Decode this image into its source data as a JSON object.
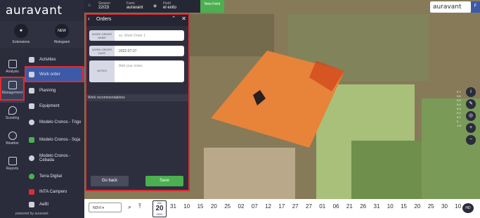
{
  "brand": {
    "logo": "auravant"
  },
  "quick": {
    "extensions": "Extensions",
    "histogram": "Histogram",
    "new_badge": "NEW"
  },
  "rail": [
    {
      "label": "Analysis"
    },
    {
      "label": "Management"
    },
    {
      "label": "Scouting"
    },
    {
      "label": "Weather"
    },
    {
      "label": "Reports"
    }
  ],
  "submenu": [
    {
      "label": "Activities"
    },
    {
      "label": "Work order"
    },
    {
      "label": "Planning"
    },
    {
      "label": "Equipment"
    },
    {
      "label": "Modelo Cronos - Trigo"
    },
    {
      "label": "Modelo Cronos - Soja"
    },
    {
      "label": "Modelo Cronos - Cebada"
    },
    {
      "label": "Terra Digital"
    },
    {
      "label": "INTA Campero"
    },
    {
      "label": "AeBI"
    }
  ],
  "powered": "powered by auravant",
  "topbar": {
    "season_label": "Season",
    "season": "22/23",
    "farm_label": "Farm",
    "farm": "auravant",
    "field_label": "Field",
    "field": "el exito",
    "new_field": "New Field"
  },
  "account": {
    "logo": "auravant",
    "avatar": "F"
  },
  "orders": {
    "title": "Orders",
    "name_label": "WORK ORDER NAME",
    "name_placeholder": "ex. Work Order 1",
    "date_label": "WORK ORDER DATE",
    "date_value": "2022-07-27",
    "notes_label": "NOTES",
    "notes_placeholder": "Add your notes",
    "recommendations": "Work recommendations",
    "go_back": "Go back",
    "save": "Save"
  },
  "legend": [
    "0.7",
    "0.6",
    "0.5",
    "0.4",
    "0.3",
    "0.2",
    "0.1",
    "0",
    "-0.1"
  ],
  "timeline": {
    "layer": "NDVI",
    "date_month": "JUL",
    "date_day": "20",
    "date_year": "2022",
    "days": [
      "31",
      "10",
      "15",
      "20",
      "25",
      "02",
      "07",
      "12",
      "17",
      "27",
      "27",
      "01",
      "06",
      "21",
      "26",
      "31",
      "10",
      "15",
      "20",
      "25",
      "30",
      "10"
    ],
    "hd": "HD"
  },
  "colors": {
    "accent": "#4caf50",
    "panel": "#2d2f3e",
    "highlight": "#e02b33",
    "active": "#3c5aa6"
  }
}
